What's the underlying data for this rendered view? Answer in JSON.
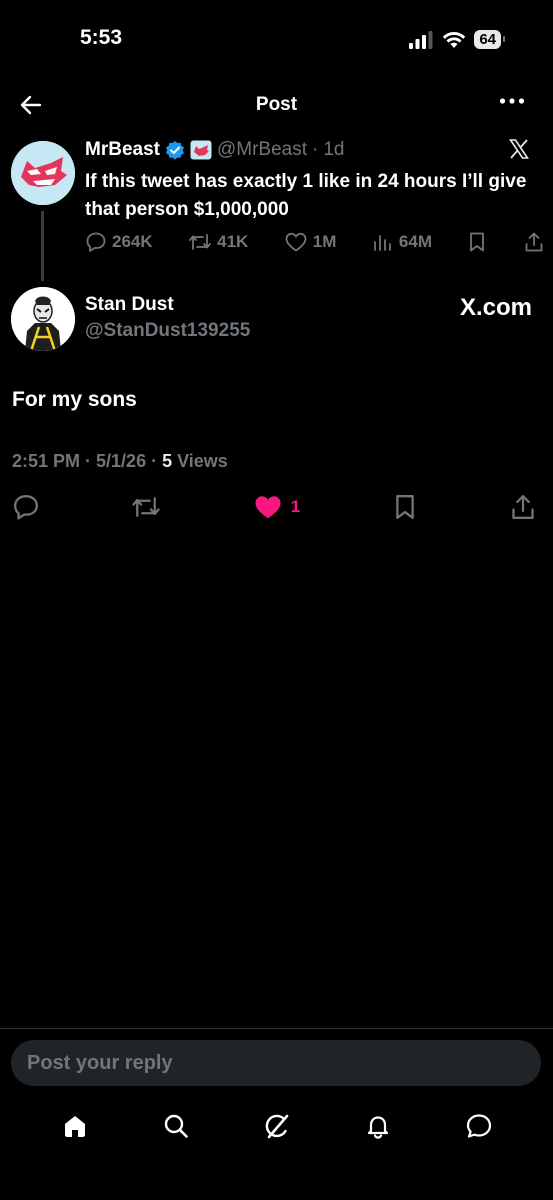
{
  "status_bar": {
    "time": "5:53",
    "battery": "64"
  },
  "header": {
    "title": "Post"
  },
  "parent_tweet": {
    "author_name": "MrBeast",
    "handle": "@MrBeast",
    "separator": "·",
    "age": "1d",
    "text": "If this tweet has exactly 1 like in 24 hours I’ll give that person $1,000,000",
    "replies": "264K",
    "reposts": "41K",
    "likes": "1M",
    "views": "64M"
  },
  "reply": {
    "author_name": "Stan Dust",
    "handle": "@StanDust139255",
    "card_label": "X.com",
    "text": "For my sons",
    "time": "2:51 PM",
    "date": "5/1/26",
    "views_count": "5",
    "views_label": "Views",
    "likes": "1"
  },
  "composer": {
    "placeholder": "Post your reply"
  },
  "colors": {
    "background": "#000000",
    "like_pink": "#f91880",
    "verified_blue": "#1d9bf0",
    "muted": "#71767b"
  },
  "icons": [
    "back-arrow-icon",
    "more-icon",
    "verified-badge-icon",
    "x-logo-icon",
    "reply-icon",
    "repost-icon",
    "like-icon",
    "views-icon",
    "bookmark-icon",
    "share-icon",
    "home-icon",
    "search-icon",
    "grok-icon",
    "bell-icon",
    "messages-icon"
  ]
}
